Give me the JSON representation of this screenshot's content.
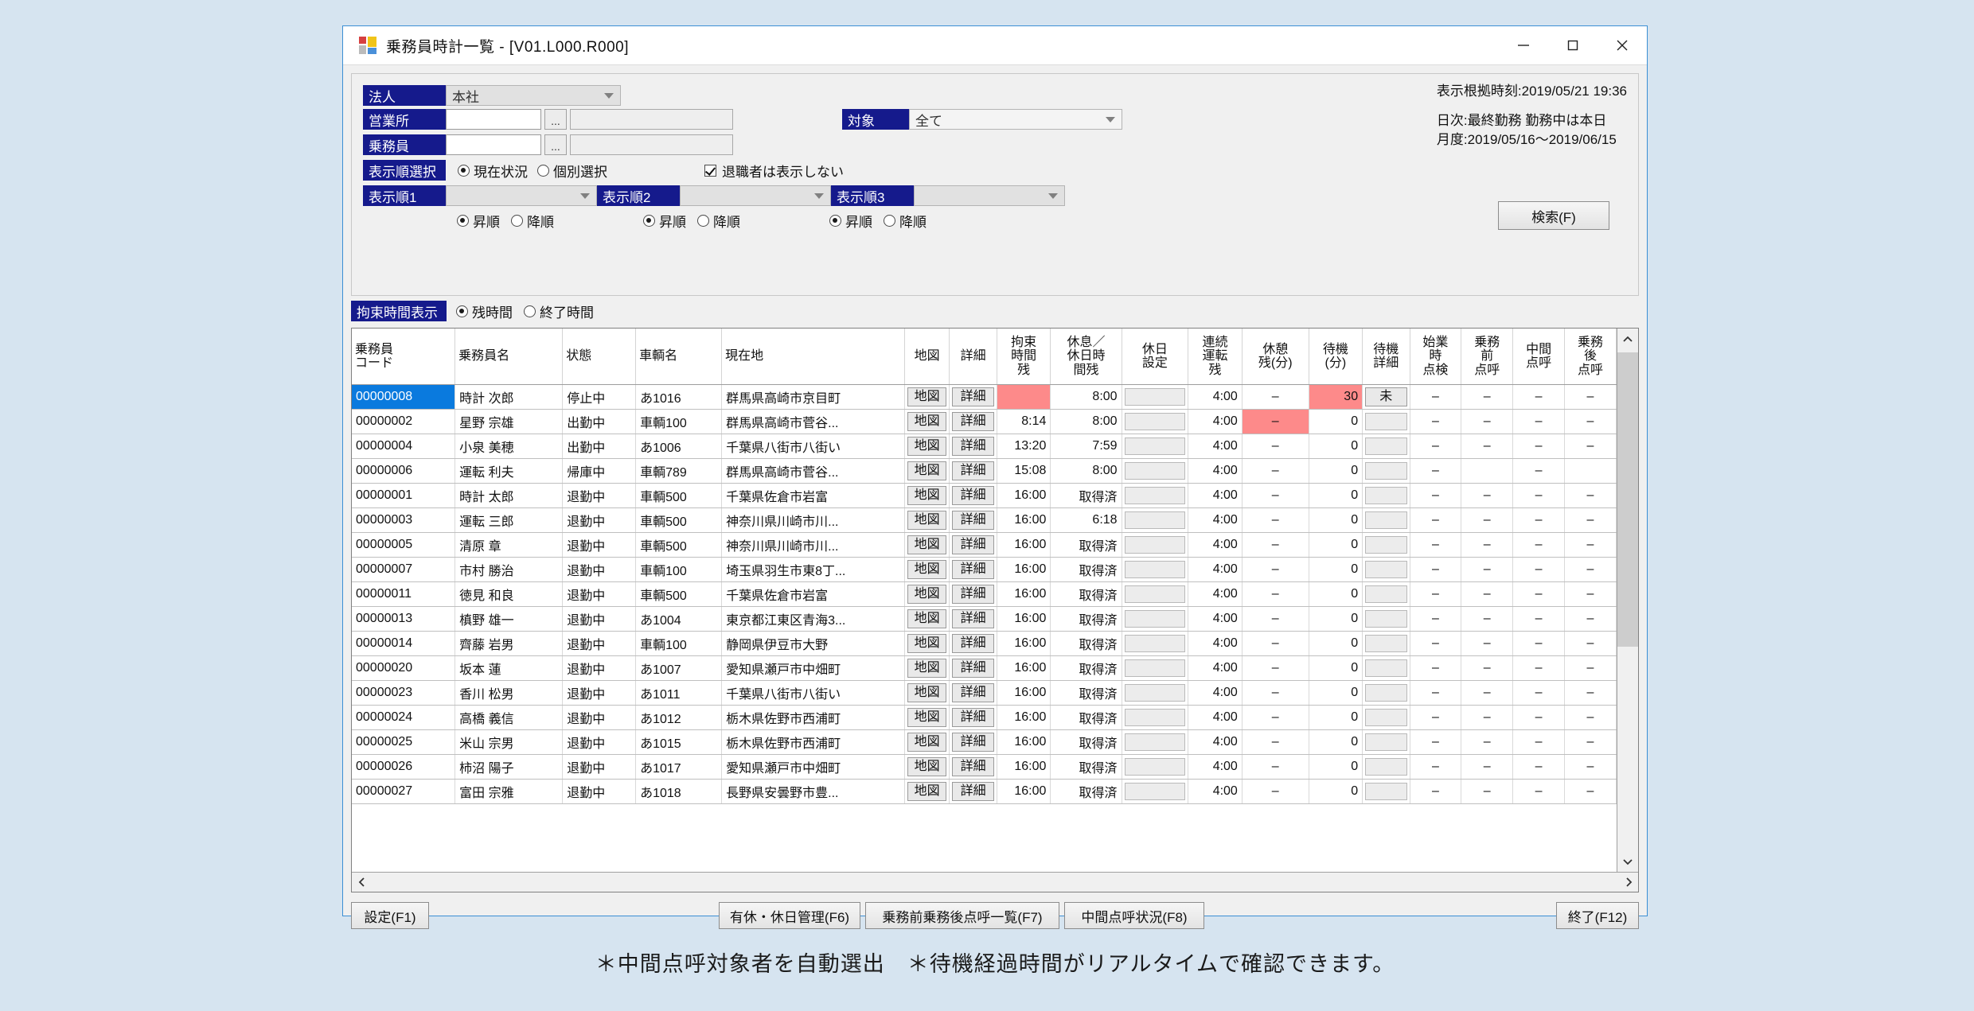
{
  "window": {
    "title": "乗務員時計一覧 - [V01.L000.R000]",
    "icon": "app-tile-icon",
    "minimize": "–",
    "maximize": "□",
    "close": "×"
  },
  "search_panel": {
    "corporation": {
      "label": "法人",
      "value": "本社"
    },
    "office": {
      "label": "営業所",
      "code": "",
      "name": "",
      "picker": "..."
    },
    "crew": {
      "label": "乗務員",
      "code": "",
      "name": "",
      "picker": "..."
    },
    "target": {
      "label": "対象",
      "value": "全て"
    },
    "display_order_select": {
      "label": "表示順選択",
      "options": [
        "現在状況",
        "個別選択"
      ],
      "selected": "現在状況"
    },
    "hide_retired": {
      "label": "退職者は表示しない",
      "checked": true
    },
    "order1": {
      "label": "表示順1",
      "value": "",
      "asc": "昇順",
      "desc": "降順",
      "selected": "昇順"
    },
    "order2": {
      "label": "表示順2",
      "value": "",
      "asc": "昇順",
      "desc": "降順",
      "selected": "昇順"
    },
    "order3": {
      "label": "表示順3",
      "value": "",
      "asc": "昇順",
      "desc": "降順",
      "selected": "昇順"
    },
    "search_button": "検索(F)"
  },
  "info": {
    "basis_time": "表示根拠時刻:2019/05/21 19:36",
    "daily": "日次:最終勤務 勤務中は本日",
    "monthly": "月度:2019/05/16～2019/06/15"
  },
  "binding_time_display": {
    "label": "拘束時間表示",
    "options": [
      "残時間",
      "終了時間"
    ],
    "selected": "残時間"
  },
  "grid": {
    "headers": [
      "乗務員\nコード",
      "乗務員名",
      "状態",
      "車輌名",
      "現在地",
      "地図",
      "詳細",
      "拘束\n時間\n残",
      "休息／\n休日時\n間残",
      "休日\n設定",
      "連続\n運転\n残",
      "休憩\n残(分)",
      "待機\n(分)",
      "待機\n詳細",
      "始業\n時\n点検",
      "乗務\n前\n点呼",
      "中間\n点呼",
      "乗務\n後\n点呼"
    ],
    "map_label": "地図",
    "detail_label": "詳細",
    "rows": [
      {
        "code": "00000008",
        "name": "時計 次郎",
        "status": "停止中",
        "vehicle": "あ1016",
        "location": "群馬県高崎市京目町",
        "bind_remain": "",
        "bind_pink": true,
        "rest_remain": "8:00",
        "holiday_set": "",
        "cont_drive": "4:00",
        "break_remain": "–",
        "break_pink": false,
        "wait_min": "30",
        "wait_pink": true,
        "wait_detail": "未",
        "wait_detail_btn": true,
        "start_check": "–",
        "pre_call": "–",
        "mid_call": "–",
        "post_call": "–",
        "selected": true
      },
      {
        "code": "00000002",
        "name": "星野 宗雄",
        "status": "出勤中",
        "vehicle": "車輌100",
        "location": "群馬県高崎市菅谷...",
        "bind_remain": "8:14",
        "bind_pink": false,
        "rest_remain": "8:00",
        "holiday_set": "",
        "cont_drive": "4:00",
        "break_remain": "–",
        "break_pink": true,
        "wait_min": "0",
        "wait_pink": false,
        "wait_detail": "",
        "wait_detail_btn": false,
        "start_check": "–",
        "pre_call": "–",
        "mid_call": "–",
        "post_call": "–",
        "selected": false
      },
      {
        "code": "00000004",
        "name": "小泉 美穂",
        "status": "出勤中",
        "vehicle": "あ1006",
        "location": "千葉県八街市八街い",
        "bind_remain": "13:20",
        "bind_pink": false,
        "rest_remain": "7:59",
        "holiday_set": "",
        "cont_drive": "4:00",
        "break_remain": "–",
        "break_pink": false,
        "wait_min": "0",
        "wait_pink": false,
        "wait_detail": "",
        "wait_detail_btn": false,
        "start_check": "–",
        "pre_call": "–",
        "mid_call": "–",
        "post_call": "–",
        "selected": false
      },
      {
        "code": "00000006",
        "name": "運転 利夫",
        "status": "帰庫中",
        "vehicle": "車輌789",
        "location": "群馬県高崎市菅谷...",
        "bind_remain": "15:08",
        "bind_pink": false,
        "rest_remain": "8:00",
        "holiday_set": "",
        "cont_drive": "4:00",
        "break_remain": "–",
        "break_pink": false,
        "wait_min": "0",
        "wait_pink": false,
        "wait_detail": "",
        "wait_detail_btn": false,
        "start_check": "–",
        "pre_call": "",
        "mid_call": "–",
        "post_call": "",
        "selected": false
      },
      {
        "code": "00000001",
        "name": "時計 太郎",
        "status": "退勤中",
        "vehicle": "車輌500",
        "location": "千葉県佐倉市岩富",
        "bind_remain": "16:00",
        "bind_pink": false,
        "rest_remain": "取得済",
        "holiday_set": "",
        "cont_drive": "4:00",
        "break_remain": "–",
        "break_pink": false,
        "wait_min": "0",
        "wait_pink": false,
        "wait_detail": "",
        "wait_detail_btn": false,
        "start_check": "–",
        "pre_call": "–",
        "mid_call": "–",
        "post_call": "–",
        "selected": false
      },
      {
        "code": "00000003",
        "name": "運転 三郎",
        "status": "退勤中",
        "vehicle": "車輌500",
        "location": "神奈川県川崎市川...",
        "bind_remain": "16:00",
        "bind_pink": false,
        "rest_remain": "6:18",
        "holiday_set": "",
        "cont_drive": "4:00",
        "break_remain": "–",
        "break_pink": false,
        "wait_min": "0",
        "wait_pink": false,
        "wait_detail": "",
        "wait_detail_btn": false,
        "start_check": "–",
        "pre_call": "–",
        "mid_call": "–",
        "post_call": "–",
        "selected": false
      },
      {
        "code": "00000005",
        "name": "清原 章",
        "status": "退勤中",
        "vehicle": "車輌500",
        "location": "神奈川県川崎市川...",
        "bind_remain": "16:00",
        "bind_pink": false,
        "rest_remain": "取得済",
        "holiday_set": "",
        "cont_drive": "4:00",
        "break_remain": "–",
        "break_pink": false,
        "wait_min": "0",
        "wait_pink": false,
        "wait_detail": "",
        "wait_detail_btn": false,
        "start_check": "–",
        "pre_call": "–",
        "mid_call": "–",
        "post_call": "–",
        "selected": false
      },
      {
        "code": "00000007",
        "name": "市村 勝治",
        "status": "退勤中",
        "vehicle": "車輌100",
        "location": "埼玉県羽生市東8丁...",
        "bind_remain": "16:00",
        "bind_pink": false,
        "rest_remain": "取得済",
        "holiday_set": "",
        "cont_drive": "4:00",
        "break_remain": "–",
        "break_pink": false,
        "wait_min": "0",
        "wait_pink": false,
        "wait_detail": "",
        "wait_detail_btn": false,
        "start_check": "–",
        "pre_call": "–",
        "mid_call": "–",
        "post_call": "–",
        "selected": false
      },
      {
        "code": "00000011",
        "name": "徳見 和良",
        "status": "退勤中",
        "vehicle": "車輌500",
        "location": "千葉県佐倉市岩富",
        "bind_remain": "16:00",
        "bind_pink": false,
        "rest_remain": "取得済",
        "holiday_set": "",
        "cont_drive": "4:00",
        "break_remain": "–",
        "break_pink": false,
        "wait_min": "0",
        "wait_pink": false,
        "wait_detail": "",
        "wait_detail_btn": false,
        "start_check": "–",
        "pre_call": "–",
        "mid_call": "–",
        "post_call": "–",
        "selected": false
      },
      {
        "code": "00000013",
        "name": "槙野 雄一",
        "status": "退勤中",
        "vehicle": "あ1004",
        "location": "東京都江東区青海3...",
        "bind_remain": "16:00",
        "bind_pink": false,
        "rest_remain": "取得済",
        "holiday_set": "",
        "cont_drive": "4:00",
        "break_remain": "–",
        "break_pink": false,
        "wait_min": "0",
        "wait_pink": false,
        "wait_detail": "",
        "wait_detail_btn": false,
        "start_check": "–",
        "pre_call": "–",
        "mid_call": "–",
        "post_call": "–",
        "selected": false
      },
      {
        "code": "00000014",
        "name": "齊藤 岩男",
        "status": "退勤中",
        "vehicle": "車輌100",
        "location": "静岡県伊豆市大野",
        "bind_remain": "16:00",
        "bind_pink": false,
        "rest_remain": "取得済",
        "holiday_set": "",
        "cont_drive": "4:00",
        "break_remain": "–",
        "break_pink": false,
        "wait_min": "0",
        "wait_pink": false,
        "wait_detail": "",
        "wait_detail_btn": false,
        "start_check": "–",
        "pre_call": "–",
        "mid_call": "–",
        "post_call": "–",
        "selected": false
      },
      {
        "code": "00000020",
        "name": "坂本 蓮",
        "status": "退勤中",
        "vehicle": "あ1007",
        "location": "愛知県瀬戸市中畑町",
        "bind_remain": "16:00",
        "bind_pink": false,
        "rest_remain": "取得済",
        "holiday_set": "",
        "cont_drive": "4:00",
        "break_remain": "–",
        "break_pink": false,
        "wait_min": "0",
        "wait_pink": false,
        "wait_detail": "",
        "wait_detail_btn": false,
        "start_check": "–",
        "pre_call": "–",
        "mid_call": "–",
        "post_call": "–",
        "selected": false
      },
      {
        "code": "00000023",
        "name": "香川 松男",
        "status": "退勤中",
        "vehicle": "あ1011",
        "location": "千葉県八街市八街い",
        "bind_remain": "16:00",
        "bind_pink": false,
        "rest_remain": "取得済",
        "holiday_set": "",
        "cont_drive": "4:00",
        "break_remain": "–",
        "break_pink": false,
        "wait_min": "0",
        "wait_pink": false,
        "wait_detail": "",
        "wait_detail_btn": false,
        "start_check": "–",
        "pre_call": "–",
        "mid_call": "–",
        "post_call": "–",
        "selected": false
      },
      {
        "code": "00000024",
        "name": "高橋 義信",
        "status": "退勤中",
        "vehicle": "あ1012",
        "location": "栃木県佐野市西浦町",
        "bind_remain": "16:00",
        "bind_pink": false,
        "rest_remain": "取得済",
        "holiday_set": "",
        "cont_drive": "4:00",
        "break_remain": "–",
        "break_pink": false,
        "wait_min": "0",
        "wait_pink": false,
        "wait_detail": "",
        "wait_detail_btn": false,
        "start_check": "–",
        "pre_call": "–",
        "mid_call": "–",
        "post_call": "–",
        "selected": false
      },
      {
        "code": "00000025",
        "name": "米山 宗男",
        "status": "退勤中",
        "vehicle": "あ1015",
        "location": "栃木県佐野市西浦町",
        "bind_remain": "16:00",
        "bind_pink": false,
        "rest_remain": "取得済",
        "holiday_set": "",
        "cont_drive": "4:00",
        "break_remain": "–",
        "break_pink": false,
        "wait_min": "0",
        "wait_pink": false,
        "wait_detail": "",
        "wait_detail_btn": false,
        "start_check": "–",
        "pre_call": "–",
        "mid_call": "–",
        "post_call": "–",
        "selected": false
      },
      {
        "code": "00000026",
        "name": "柿沼 陽子",
        "status": "退勤中",
        "vehicle": "あ1017",
        "location": "愛知県瀬戸市中畑町",
        "bind_remain": "16:00",
        "bind_pink": false,
        "rest_remain": "取得済",
        "holiday_set": "",
        "cont_drive": "4:00",
        "break_remain": "–",
        "break_pink": false,
        "wait_min": "0",
        "wait_pink": false,
        "wait_detail": "",
        "wait_detail_btn": false,
        "start_check": "–",
        "pre_call": "–",
        "mid_call": "–",
        "post_call": "–",
        "selected": false
      },
      {
        "code": "00000027",
        "name": "富田 宗雅",
        "status": "退勤中",
        "vehicle": "あ1018",
        "location": "長野県安曇野市豊...",
        "bind_remain": "16:00",
        "bind_pink": false,
        "rest_remain": "取得済",
        "holiday_set": "",
        "cont_drive": "4:00",
        "break_remain": "–",
        "break_pink": false,
        "wait_min": "0",
        "wait_pink": false,
        "wait_detail": "",
        "wait_detail_btn": false,
        "start_check": "–",
        "pre_call": "–",
        "mid_call": "–",
        "post_call": "–",
        "selected": false
      }
    ]
  },
  "bottom_buttons": {
    "settings": "設定(F1)",
    "holiday_mgmt": "有休・休日管理(F6)",
    "call_list": "乗務前乗務後点呼一覧(F7)",
    "mid_call_status": "中間点呼状況(F8)",
    "exit": "終了(F12)"
  },
  "caption": "＊中間点呼対象者を自動選出　＊待機経過時間がリアルタイムで確認できます。",
  "colors": {
    "label_blue": "#151a8c",
    "selection_blue": "#0a7ade",
    "alert_pink": "#fd8a8a",
    "window_border": "#3b8fd4",
    "page_bg": "#d6e4f0"
  }
}
